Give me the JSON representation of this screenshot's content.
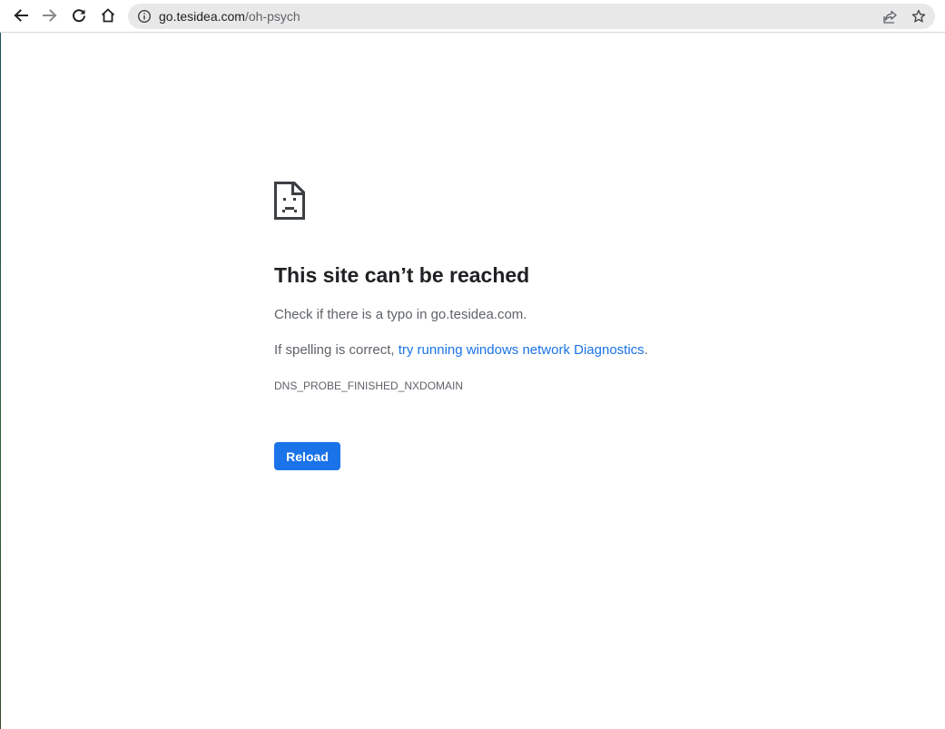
{
  "browser": {
    "url_host": "go.tesidea.com",
    "url_path": "/oh-psych",
    "icons": {
      "back": "arrow-left-icon",
      "forward": "arrow-right-icon",
      "reload": "reload-icon",
      "home": "home-icon",
      "site_info": "info-icon",
      "share": "share-icon",
      "bookmark": "star-icon"
    }
  },
  "error_page": {
    "icon": "sad-document-icon",
    "title": "This site can’t be reached",
    "typo_message": "Check if there is a typo in go.tesidea.com.",
    "spelling_prefix": "If spelling is correct, ",
    "diagnostics_link": "try running windows network Diagnostics",
    "spelling_suffix": ".",
    "error_code": "DNS_PROBE_FINISHED_NXDOMAIN",
    "reload_label": "Reload"
  },
  "colors": {
    "accent": "#1a73e8",
    "text_primary": "#202124",
    "text_secondary": "#5f6368",
    "omnibox_bg": "#e8e8e8"
  }
}
